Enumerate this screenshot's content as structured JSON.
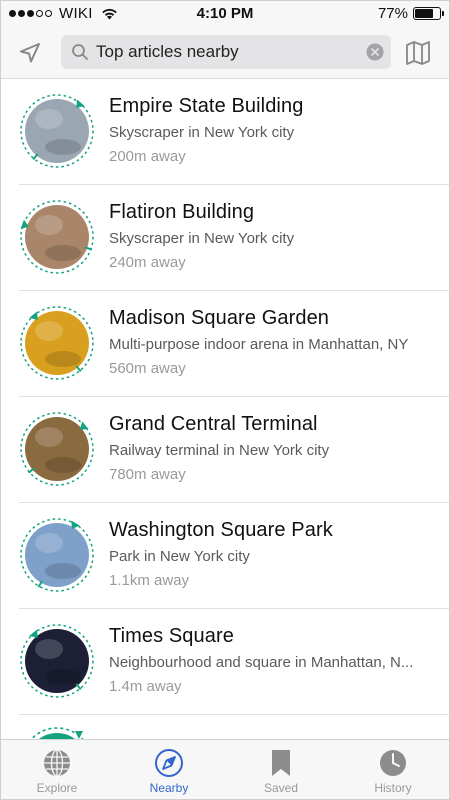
{
  "status_bar": {
    "carrier": "WIKI",
    "time": "4:10 PM",
    "battery": "77%",
    "battery_level": 0.77,
    "signal_bars_filled": 3,
    "signal_bars_total": 5
  },
  "search": {
    "value": "Top articles nearby",
    "placeholder": "Search"
  },
  "icons": {
    "locate": "location-arrow-icon",
    "search": "search-icon",
    "clear": "clear-icon",
    "map": "map-icon"
  },
  "results": [
    {
      "title": "Empire State Building",
      "description": "Skyscraper in New York city",
      "distance": "200m away",
      "thumb_color": "#9aa7b3"
    },
    {
      "title": "Flatiron Building",
      "description": "Skyscraper in New York city",
      "distance": "240m away",
      "thumb_color": "#a9866a"
    },
    {
      "title": "Madison Square Garden",
      "description": "Multi-purpose indoor arena in Manhattan, NY",
      "distance": "560m away",
      "thumb_color": "#d9a020"
    },
    {
      "title": "Grand Central Terminal",
      "description": "Railway terminal in New York city",
      "distance": "780m away",
      "thumb_color": "#8a6a3f"
    },
    {
      "title": "Washington Square Park",
      "description": "Park in New York city",
      "distance": "1.1km away",
      "thumb_color": "#7fa0c8"
    },
    {
      "title": "Times Square",
      "description": "Neighbourhood and square in Manhattan, N...",
      "distance": "1.4m away",
      "thumb_color": "#1c1f35"
    }
  ],
  "accent_color": "#14a37f",
  "tabs": [
    {
      "label": "Explore",
      "icon": "globe-icon",
      "active": false
    },
    {
      "label": "Nearby",
      "icon": "compass-icon",
      "active": true
    },
    {
      "label": "Saved",
      "icon": "bookmark-icon",
      "active": false
    },
    {
      "label": "History",
      "icon": "clock-icon",
      "active": false
    }
  ]
}
